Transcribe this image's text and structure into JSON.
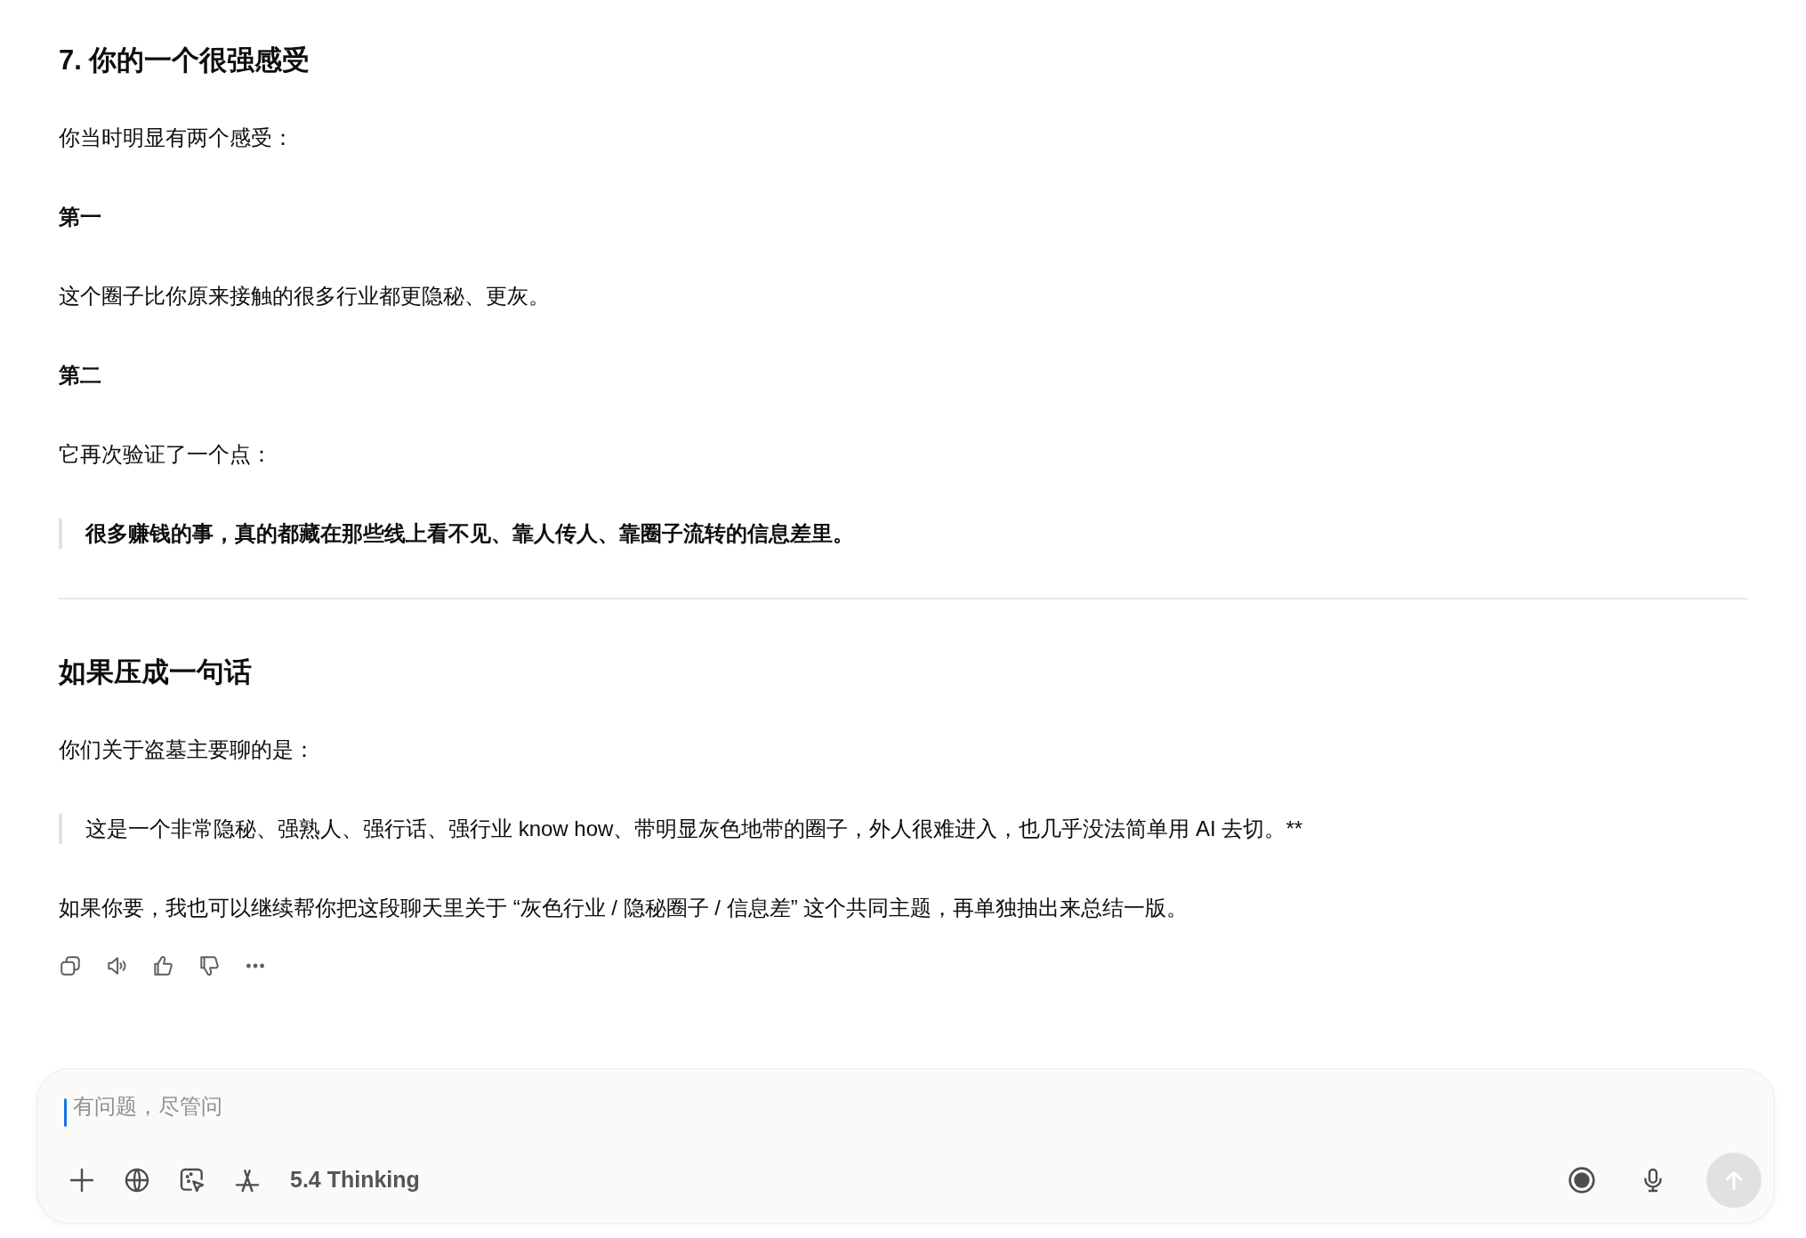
{
  "blocks": [
    {
      "kind": "heading",
      "text": "7. 你的一个很强感受"
    },
    {
      "kind": "paragraph",
      "text": "你当时明显有两个感受："
    },
    {
      "kind": "label",
      "text": "第一"
    },
    {
      "kind": "paragraph",
      "text": "这个圈子比你原来接触的很多行业都更隐秘、更灰。"
    },
    {
      "kind": "label",
      "text": "第二"
    },
    {
      "kind": "paragraph",
      "text": "它再次验证了一个点："
    },
    {
      "kind": "quote",
      "bold": true,
      "text": "很多赚钱的事，真的都藏在那些线上看不见、靠人传人、靠圈子流转的信息差里。"
    },
    {
      "kind": "rule"
    },
    {
      "kind": "heading",
      "text": "如果压成一句话"
    },
    {
      "kind": "paragraph",
      "text": "你们关于盗墓主要聊的是："
    },
    {
      "kind": "quote",
      "bold": false,
      "text": "这是一个非常隐秘、强熟人、强行话、强行业 know how、带明显灰色地带的圈子，外人很难进入，也几乎没法简单用 AI 去切。**"
    },
    {
      "kind": "paragraph",
      "text": "如果你要，我也可以继续帮你把这段聊天里关于 “灰色行业 / 隐秘圈子 / 信息差” 这个共同主题，再单独抽出来总结一版。"
    }
  ],
  "composer": {
    "placeholder": "有问题，尽管问",
    "model": "5.4 Thinking",
    "send_enabled": false
  }
}
